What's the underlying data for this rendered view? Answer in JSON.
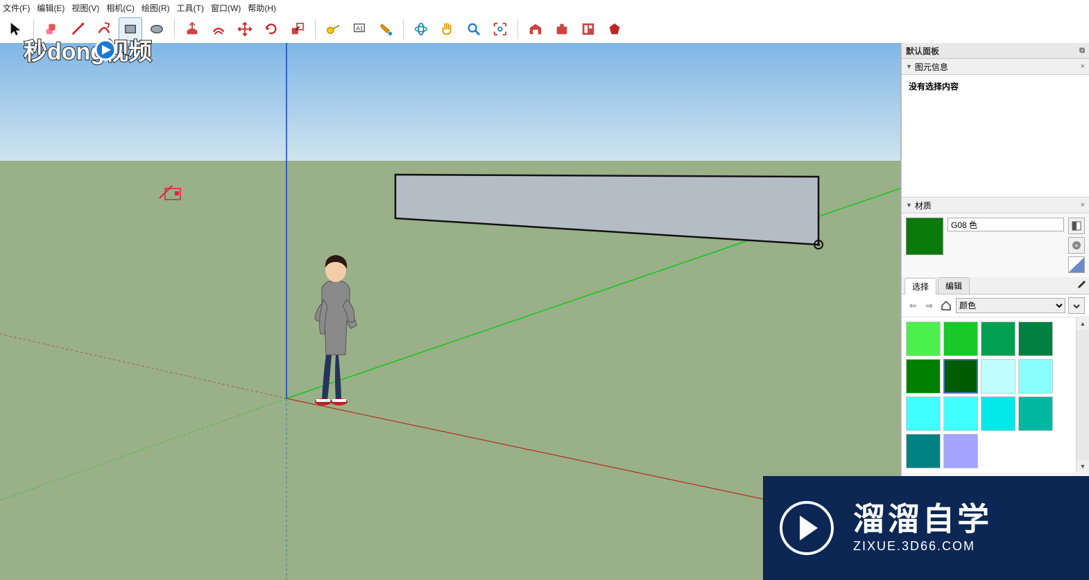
{
  "menu": {
    "file": "文件(F)",
    "edit": "编辑(E)",
    "view": "视图(V)",
    "camera": "相机(C)",
    "draw": "绘图(R)",
    "tools": "工具(T)",
    "window": "窗口(W)",
    "help": "帮助(H)"
  },
  "toolbar": {
    "active_tool": "rectangle"
  },
  "scene": {
    "selected_tool": "rectangle",
    "has_default_figure": true
  },
  "panels": {
    "tray_title": "默认面板",
    "entity": {
      "title": "图元信息",
      "empty_text": "没有选择内容"
    },
    "materials": {
      "title": "材质",
      "current_name": "G08 色",
      "current_color": "#0a7a0a",
      "tabs": {
        "select": "选择",
        "edit": "编辑"
      },
      "active_tab": "select",
      "library_dropdown": "颜色",
      "swatches": [
        "#4cf04c",
        "#17c828",
        "#00a050",
        "#008040",
        "#008000",
        "#005c00",
        "#c0ffff",
        "#88ffff",
        "#40ffff",
        "#40ffff",
        "#00e8e8",
        "#00b8a0",
        "#008080",
        "#a4a4ff"
      ],
      "selected_swatch_index": 5
    }
  },
  "watermarks": {
    "top_left": "秒dong视频",
    "bottom_right_big": "溜溜自学",
    "bottom_right_small": "ZIXUE.3D66.COM"
  }
}
